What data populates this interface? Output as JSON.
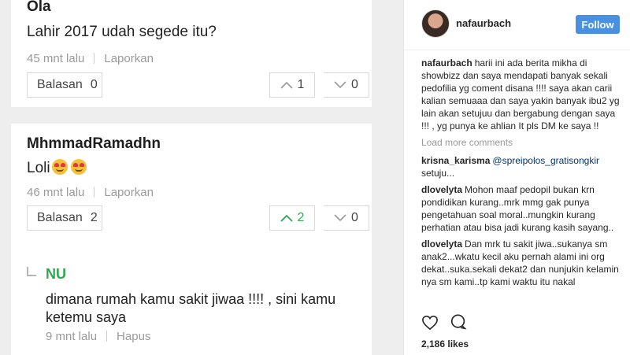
{
  "comments": [
    {
      "author": "Ola",
      "text": "Lahir 2017 udah segede itu?",
      "time": "45 mnt lalu",
      "report_label": "Laporkan",
      "reply_label": "Balasan",
      "reply_count": "0",
      "upvotes": "1",
      "downvotes": "0"
    },
    {
      "author": "MhmmadRamadhn",
      "text": "Loli",
      "emoji": [
        "heart-eyes-emoji",
        "heart-eyes-emoji"
      ],
      "time": "46 mnt lalu",
      "report_label": "Laporkan",
      "reply_label": "Balasan",
      "reply_count": "2",
      "upvotes": "2",
      "downvotes": "0",
      "upvote_active": true
    }
  ],
  "reply": {
    "author": "NU",
    "text_line1": "dimana rumah kamu sakit jiwaa !!!! , sini kamu",
    "text_line2": "ketemu saya",
    "time": "9 mnt lalu",
    "delete_label": "Hapus"
  },
  "instagram": {
    "username": "nafaurbach",
    "follow_label": "Follow",
    "caption_user": "nafaurbach",
    "caption": "harii ini ada berita mikha di showbizz dan saya mendapati banyak sekali pedofilia yg coment disana !!!! saya akan carii kalian semuaaa dan saya yakin banyak ibu2 yg lain akan setujuu dan bergabung dengan saya !!! , yg punya ke ahlian It pls DM ke saya !!",
    "load_more": "Load more comments",
    "comments": [
      {
        "user": "krisna_karisma",
        "mention": "@spreipolos_gratisongkir",
        "text": "setuju..."
      },
      {
        "user": "dlovelyta",
        "text": "Mohon maaf pedopil bukan krn pondidikan kurang..mrk mmg gak punya pengetahuan soal moral..mungkin kurang perhatian atau bisa jadi kurang kasih sayang.."
      },
      {
        "user": "dlovelyta",
        "text": "Dan mrk tu sakit jiwa..sukanya sm anak2...wkatu kecil aku pernah alami ini org dekat..suka.sekali dekat2 dan nunjukin kelamin nya sm kami..tp kami waktu itu nakal"
      }
    ],
    "likes": "2,186 likes"
  },
  "colors": {
    "accent_green": "#2ea84e",
    "follow_blue": "#4a90e2",
    "muted_text": "#9a9a9a"
  },
  "icons": [
    "arrow-up-icon",
    "arrow-down-icon",
    "heart-icon",
    "comment-icon",
    "reply-corner-icon"
  ]
}
